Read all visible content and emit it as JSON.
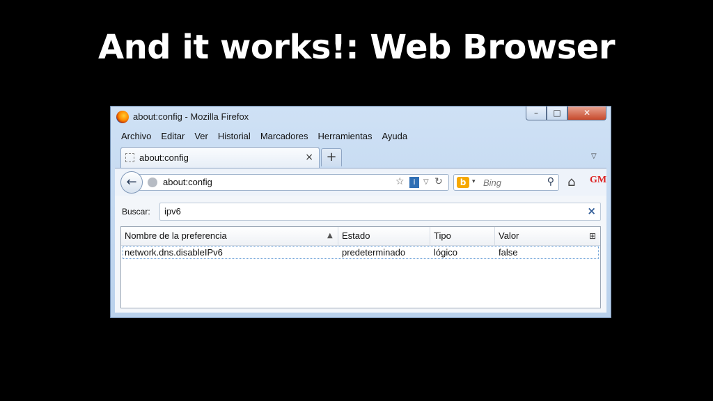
{
  "slide": {
    "title": "And it works!: Web Browser"
  },
  "window": {
    "title": "about:config - Mozilla Firefox",
    "controls": {
      "minimize": "–",
      "maximize": "□",
      "close": "✕"
    }
  },
  "menu": {
    "items": [
      "Archivo",
      "Editar",
      "Ver",
      "Historial",
      "Marcadores",
      "Herramientas",
      "Ayuda"
    ]
  },
  "tabs": [
    {
      "label": "about:config",
      "close": "×"
    }
  ],
  "newtab": "+",
  "navbar": {
    "url": "about:config",
    "search_placeholder": "Bing",
    "search_engine_icon": "bing-icon"
  },
  "search": {
    "label": "Buscar:",
    "value": "ipv6"
  },
  "table": {
    "columns": [
      "Nombre de la preferencia",
      "Estado",
      "Tipo",
      "Valor"
    ],
    "rows": [
      {
        "name": "network.dns.disableIPv6",
        "status": "predeterminado",
        "type": "lógico",
        "value": "false"
      }
    ]
  },
  "icons": [
    "firefox-logo",
    "back-arrow-icon",
    "globe-icon",
    "star-icon",
    "identity-icon",
    "reload-icon",
    "search-icon",
    "home-icon",
    "gm-icon",
    "sort-icon",
    "column-picker-icon",
    "clear-icon"
  ]
}
